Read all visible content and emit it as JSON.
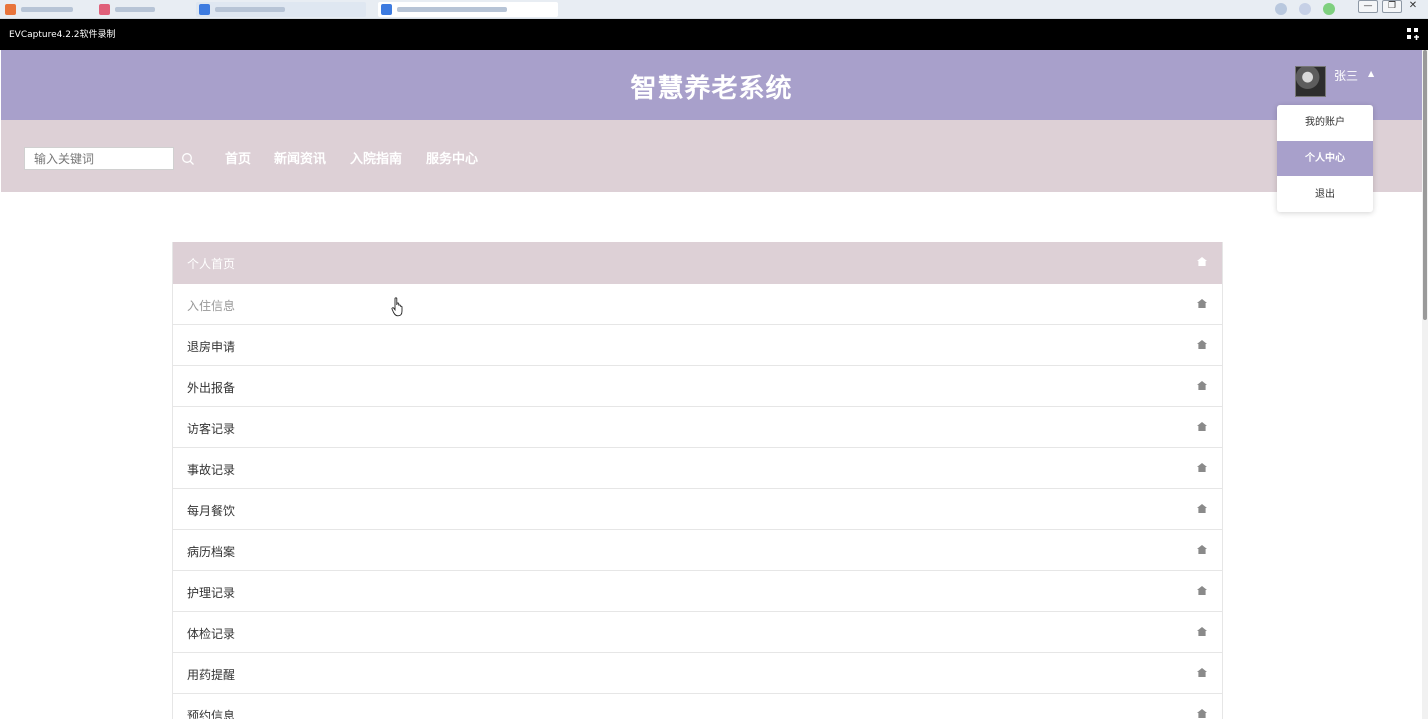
{
  "capture": {
    "title": "EVCapture4.2.2软件录制"
  },
  "header": {
    "site_title": "智慧养老系统"
  },
  "user": {
    "name": "张三"
  },
  "search": {
    "placeholder": "输入关键词"
  },
  "nav": [
    {
      "label": "首页"
    },
    {
      "label": "新闻资讯"
    },
    {
      "label": "入院指南"
    },
    {
      "label": "服务中心"
    }
  ],
  "dropdown": [
    {
      "label": "我的账户"
    },
    {
      "label": "个人中心"
    },
    {
      "label": "退出"
    }
  ],
  "menu": {
    "items": [
      {
        "label": "个人首页"
      },
      {
        "label": "入住信息"
      },
      {
        "label": "退房申请"
      },
      {
        "label": "外出报备"
      },
      {
        "label": "访客记录"
      },
      {
        "label": "事故记录"
      },
      {
        "label": "每月餐饮"
      },
      {
        "label": "病历档案"
      },
      {
        "label": "护理记录"
      },
      {
        "label": "体检记录"
      },
      {
        "label": "用药提醒"
      },
      {
        "label": "预约信息"
      }
    ]
  },
  "colors": {
    "header_bg": "#a8a0cb",
    "nav_bg": "#ddd0d6",
    "active_item": "#a8a0cb"
  }
}
